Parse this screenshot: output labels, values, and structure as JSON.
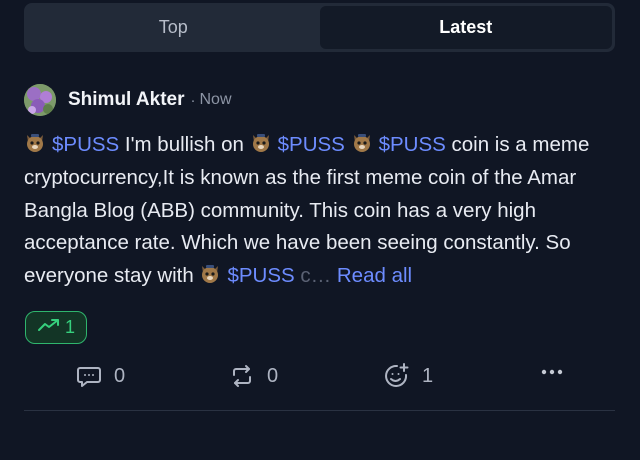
{
  "tabs": [
    {
      "label": "Top",
      "active": false
    },
    {
      "label": "Latest",
      "active": true
    }
  ],
  "post": {
    "author": "Shimul Akter",
    "separator": "·",
    "time": "Now",
    "text": {
      "tag1": "$PUSS",
      "seg1": " I'm bullish on ",
      "tag2": "$PUSS",
      "tag3": "$PUSS",
      "seg2": " coin is a meme cryptocurrency,It is known as the first meme coin of the Amar Bangla Blog (ABB) community. This coin has a very high acceptance rate. Which we have been seeing constantly. So everyone stay with ",
      "tag4": "$PUSS",
      "seg3": " c",
      "ellipsis": "…",
      "read_more": "Read all"
    },
    "trend_count": "1",
    "actions": {
      "comments": "0",
      "reposts": "0",
      "reactions": "1"
    }
  },
  "icons": {
    "tag_icon": "cat-face-icon",
    "trend": "trending-up-icon",
    "comment": "comment-icon",
    "repost": "repost-icon",
    "reaction": "add-reaction-icon",
    "more": "more-horizontal-icon"
  },
  "colors": {
    "background": "#101624",
    "tab_bar": "#222a38",
    "tab_active": "#131a27",
    "link": "#6d8cff",
    "trend_green": "#36d07d"
  }
}
